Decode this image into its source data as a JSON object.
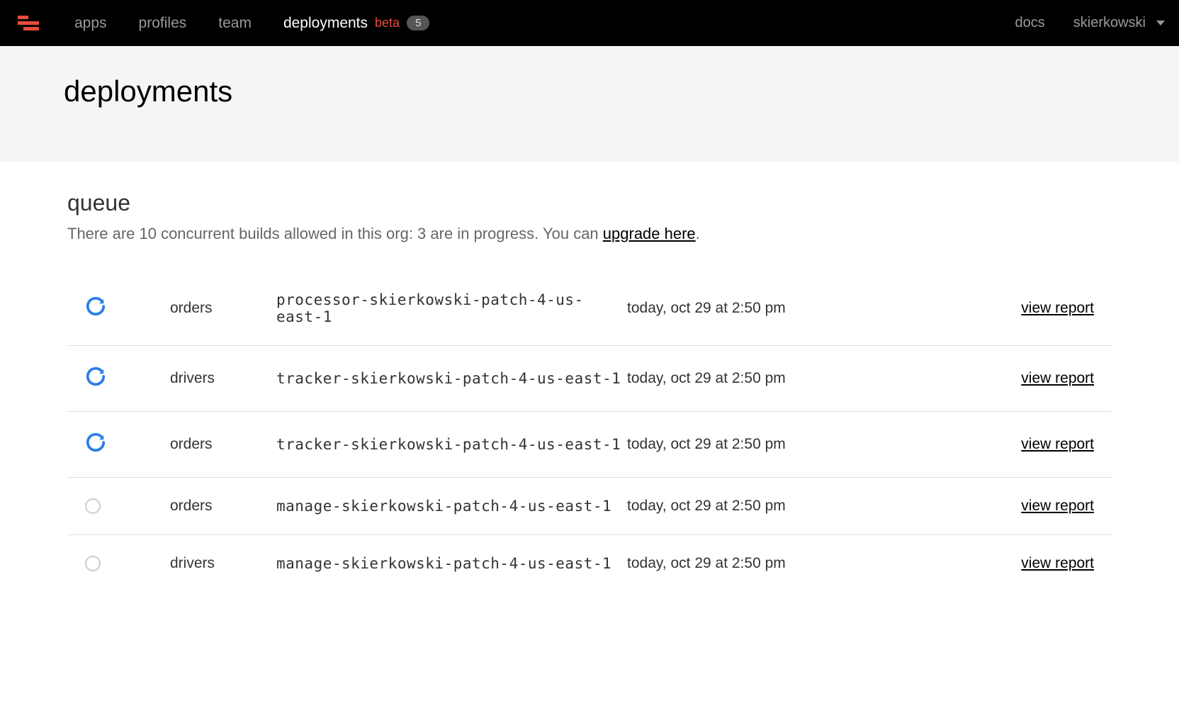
{
  "nav": {
    "items": [
      {
        "label": "apps"
      },
      {
        "label": "profiles"
      },
      {
        "label": "team"
      },
      {
        "label": "deployments",
        "beta": "beta",
        "count": "5"
      }
    ],
    "docs": "docs",
    "user": "skierkowski"
  },
  "page": {
    "title": "deployments"
  },
  "queue": {
    "title": "queue",
    "desc_prefix": "There are 10 concurrent builds allowed in this org: 3 are in progress. You can ",
    "desc_link": "upgrade here",
    "desc_suffix": ".",
    "rows": [
      {
        "status": "active",
        "app": "orders",
        "name": "processor-skierkowski-patch-4-us-east-1",
        "time": "today, oct 29 at 2:50 pm",
        "action": "view report"
      },
      {
        "status": "active",
        "app": "drivers",
        "name": "tracker-skierkowski-patch-4-us-east-1",
        "time": "today, oct 29 at 2:50 pm",
        "action": "view report"
      },
      {
        "status": "active",
        "app": "orders",
        "name": "tracker-skierkowski-patch-4-us-east-1",
        "time": "today, oct 29 at 2:50 pm",
        "action": "view report"
      },
      {
        "status": "idle",
        "app": "orders",
        "name": "manage-skierkowski-patch-4-us-east-1",
        "time": "today, oct 29 at 2:50 pm",
        "action": "view report"
      },
      {
        "status": "idle",
        "app": "drivers",
        "name": "manage-skierkowski-patch-4-us-east-1",
        "time": "today, oct 29 at 2:50 pm",
        "action": "view report"
      }
    ]
  }
}
